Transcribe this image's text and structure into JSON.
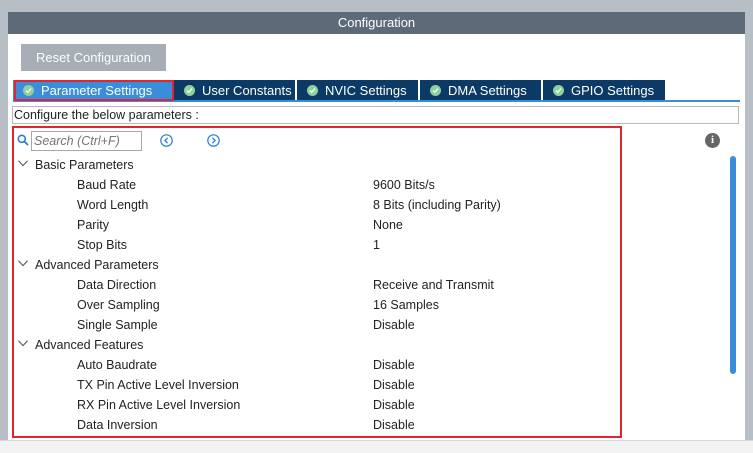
{
  "window": {
    "title": "Configuration"
  },
  "toolbar": {
    "reset_label": "Reset Configuration"
  },
  "tabs": [
    {
      "label": "Parameter Settings",
      "active": true,
      "icon": "check-circle-icon"
    },
    {
      "label": "User Constants",
      "active": false,
      "icon": "check-circle-icon"
    },
    {
      "label": "NVIC Settings",
      "active": false,
      "icon": "check-circle-icon"
    },
    {
      "label": "DMA Settings",
      "active": false,
      "icon": "check-circle-icon"
    },
    {
      "label": "GPIO Settings",
      "active": false,
      "icon": "check-circle-icon"
    }
  ],
  "instructions": "Configure the below parameters :",
  "search": {
    "placeholder": "Search (Ctrl+F)",
    "value": ""
  },
  "groups": [
    {
      "label": "Basic Parameters",
      "params": [
        {
          "name": "Baud Rate",
          "value": "9600 Bits/s"
        },
        {
          "name": "Word Length",
          "value": "8 Bits (including Parity)"
        },
        {
          "name": "Parity",
          "value": "None"
        },
        {
          "name": "Stop Bits",
          "value": "1"
        }
      ]
    },
    {
      "label": "Advanced Parameters",
      "params": [
        {
          "name": "Data Direction",
          "value": "Receive and Transmit"
        },
        {
          "name": "Over Sampling",
          "value": "16 Samples"
        },
        {
          "name": "Single Sample",
          "value": "Disable"
        }
      ]
    },
    {
      "label": "Advanced Features",
      "params": [
        {
          "name": "Auto Baudrate",
          "value": "Disable"
        },
        {
          "name": "TX Pin Active Level Inversion",
          "value": "Disable"
        },
        {
          "name": "RX Pin Active Level Inversion",
          "value": "Disable"
        },
        {
          "name": "Data Inversion",
          "value": "Disable"
        }
      ]
    }
  ],
  "colors": {
    "title_bar": "#5d6b79",
    "tab_active": "#3a8ddb",
    "tab_inactive": "#0b3a66",
    "highlight": "#e2262f",
    "check": "#8fd19a"
  }
}
